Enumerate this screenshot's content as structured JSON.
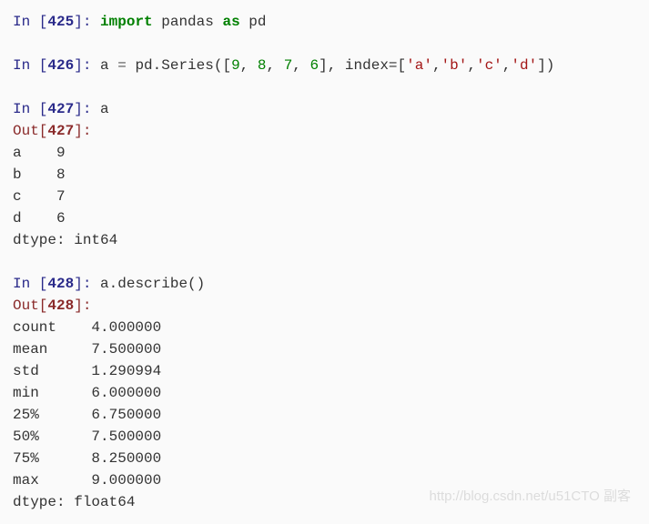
{
  "cells": [
    {
      "type": "in",
      "num": "425",
      "tokens": [
        {
          "t": "import ",
          "c": "kw"
        },
        {
          "t": "pandas ",
          "c": ""
        },
        {
          "t": "as ",
          "c": "kw"
        },
        {
          "t": "pd",
          "c": ""
        }
      ]
    },
    {
      "type": "blank"
    },
    {
      "type": "in",
      "num": "426",
      "tokens": [
        {
          "t": "a ",
          "c": ""
        },
        {
          "t": "= ",
          "c": "op"
        },
        {
          "t": "pd.Series([",
          "c": ""
        },
        {
          "t": "9",
          "c": "num"
        },
        {
          "t": ", ",
          "c": ""
        },
        {
          "t": "8",
          "c": "num"
        },
        {
          "t": ", ",
          "c": ""
        },
        {
          "t": "7",
          "c": "num"
        },
        {
          "t": ", ",
          "c": ""
        },
        {
          "t": "6",
          "c": "num"
        },
        {
          "t": "], index=[",
          "c": ""
        },
        {
          "t": "'a'",
          "c": "str"
        },
        {
          "t": ",",
          "c": ""
        },
        {
          "t": "'b'",
          "c": "str"
        },
        {
          "t": ",",
          "c": ""
        },
        {
          "t": "'c'",
          "c": "str"
        },
        {
          "t": ",",
          "c": ""
        },
        {
          "t": "'d'",
          "c": "str"
        },
        {
          "t": "])",
          "c": ""
        }
      ]
    },
    {
      "type": "blank"
    },
    {
      "type": "in",
      "num": "427",
      "tokens": [
        {
          "t": "a",
          "c": ""
        }
      ]
    },
    {
      "type": "out",
      "num": "427"
    },
    {
      "type": "plain",
      "text": "a    9"
    },
    {
      "type": "plain",
      "text": "b    8"
    },
    {
      "type": "plain",
      "text": "c    7"
    },
    {
      "type": "plain",
      "text": "d    6"
    },
    {
      "type": "plain",
      "text": "dtype: int64"
    },
    {
      "type": "blank"
    },
    {
      "type": "in",
      "num": "428",
      "tokens": [
        {
          "t": "a.describe()",
          "c": ""
        }
      ]
    },
    {
      "type": "out",
      "num": "428"
    },
    {
      "type": "plain",
      "text": "count    4.000000"
    },
    {
      "type": "plain",
      "text": "mean     7.500000"
    },
    {
      "type": "plain",
      "text": "std      1.290994"
    },
    {
      "type": "plain",
      "text": "min      6.000000"
    },
    {
      "type": "plain",
      "text": "25%      6.750000"
    },
    {
      "type": "plain",
      "text": "50%      7.500000"
    },
    {
      "type": "plain",
      "text": "75%      8.250000"
    },
    {
      "type": "plain",
      "text": "max      9.000000"
    },
    {
      "type": "plain",
      "text": "dtype: float64"
    }
  ],
  "labels": {
    "in_prefix": "In [",
    "out_prefix": "Out[",
    "prompt_suffix": "]: "
  },
  "watermark": "http://blog.csdn.net/u51CTO 副客",
  "chart_data": {
    "type": "table",
    "title": "pandas Series describe() output",
    "series_data": {
      "index": [
        "a",
        "b",
        "c",
        "d"
      ],
      "values": [
        9,
        8,
        7,
        6
      ],
      "dtype": "int64"
    },
    "describe": {
      "count": 4.0,
      "mean": 7.5,
      "std": 1.290994,
      "min": 6.0,
      "25%": 6.75,
      "50%": 7.5,
      "75%": 8.25,
      "max": 9.0,
      "dtype": "float64"
    }
  }
}
